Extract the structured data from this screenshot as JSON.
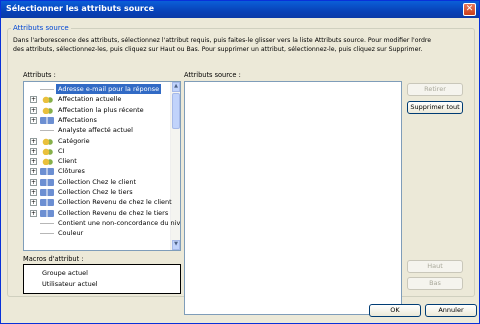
{
  "window": {
    "title": "Sélectionner les attributs source",
    "close_symbol": "✕"
  },
  "group": {
    "title": "Attributs source",
    "instruction_line1": "Dans l'arborescence des attributs, sélectionnez l'attribut requis, puis faites-le glisser vers la liste Attributs source. Pour modifier l'ordre",
    "instruction_line2": "des attributs, sélectionnez-les, puis cliquez sur Haut ou Bas. Pour supprimer un attribut, sélectionnez-le, puis cliquez sur Supprimer."
  },
  "labels": {
    "attributs": "Attributs :",
    "attributs_source": "Attributs source :",
    "macros": "Macros d'attribut :"
  },
  "tree": {
    "items": [
      {
        "label": "Adresse e-mail pour la réponse",
        "icon": "gray",
        "expand": false,
        "selected": true
      },
      {
        "label": "Affectation actuelle",
        "icon": "yellow",
        "expand": true
      },
      {
        "label": "Affectation la plus récente",
        "icon": "yellow",
        "expand": true
      },
      {
        "label": "Affectations",
        "icon": "blue",
        "expand": true
      },
      {
        "label": "Analyste affecté actuel",
        "icon": "gray",
        "expand": false
      },
      {
        "label": "Catégorie",
        "icon": "yellow",
        "expand": true
      },
      {
        "label": "CI",
        "icon": "yellow",
        "expand": true
      },
      {
        "label": "Client",
        "icon": "yellow",
        "expand": true
      },
      {
        "label": "Clôtures",
        "icon": "blue",
        "expand": true
      },
      {
        "label": "Collection Chez le client",
        "icon": "blue",
        "expand": true
      },
      {
        "label": "Collection Chez le tiers",
        "icon": "blue",
        "expand": true
      },
      {
        "label": "Collection Revenu de chez le client",
        "icon": "blue",
        "expand": true
      },
      {
        "label": "Collection Revenu de chez le tiers",
        "icon": "blue",
        "expand": true
      },
      {
        "label": "Contient une non-concordance du nive",
        "icon": "gray",
        "expand": false
      },
      {
        "label": "Couleur",
        "icon": "gray",
        "expand": false
      }
    ]
  },
  "macros": {
    "items": [
      {
        "label": "Groupe actuel"
      },
      {
        "label": "Utilisateur actuel"
      }
    ]
  },
  "buttons": {
    "retirer": "Retirer",
    "supprimer_tout": "Supprimer tout",
    "haut": "Haut",
    "bas": "Bas",
    "ok": "OK",
    "annuler": "Annuler"
  }
}
